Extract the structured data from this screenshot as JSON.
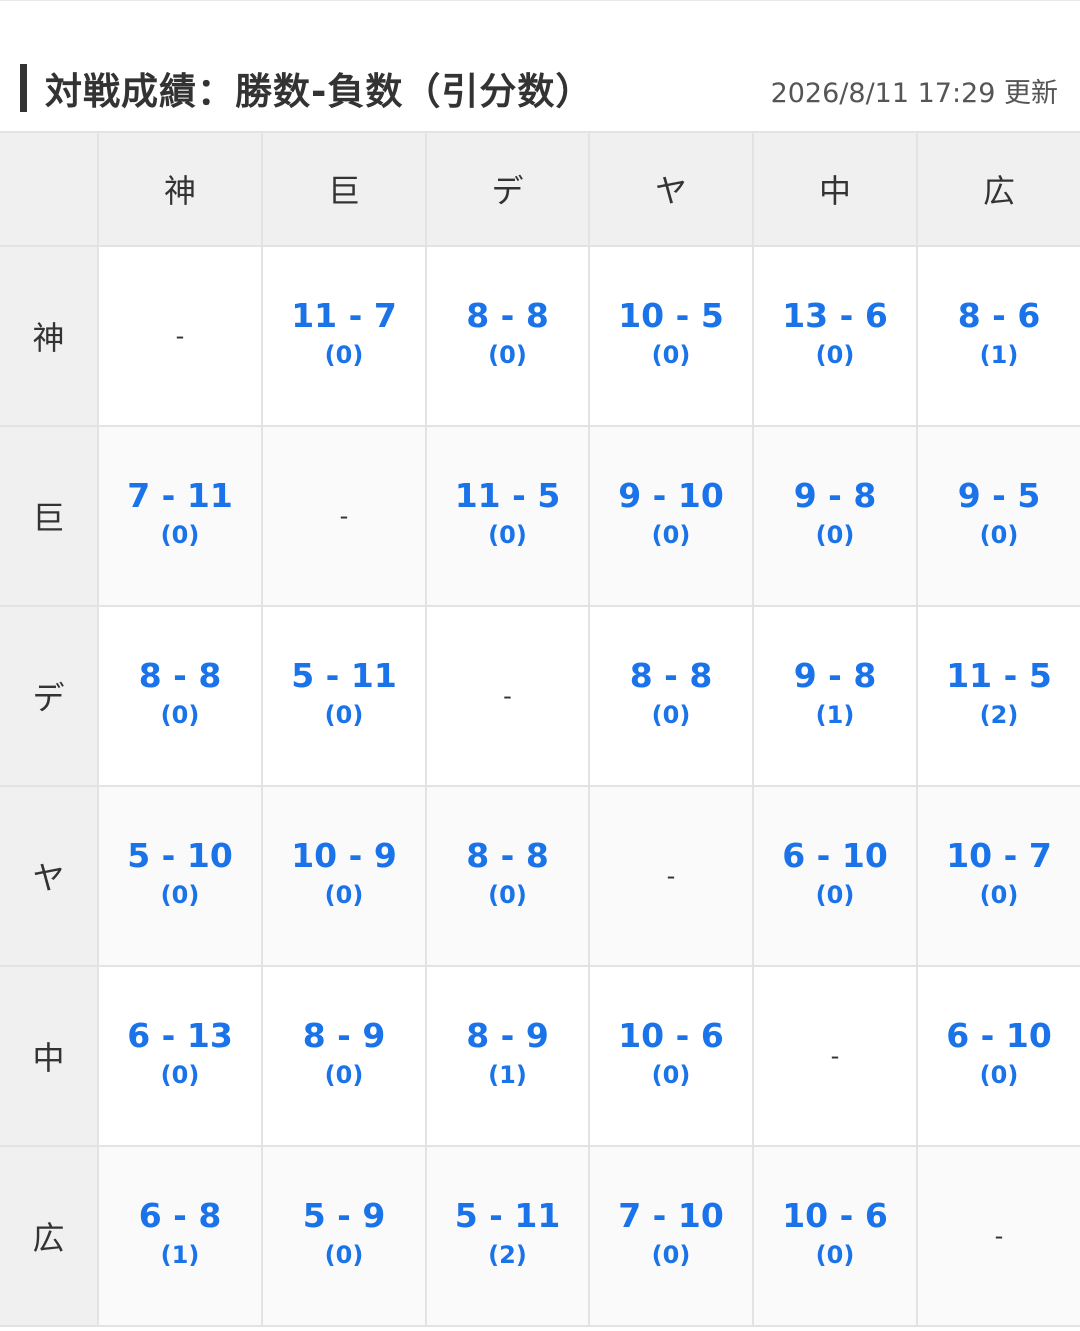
{
  "header": {
    "title": "対戦成績：勝数-負数（引分数）",
    "updated": "2026/8/11 17:29 更新"
  },
  "teams": [
    "神",
    "巨",
    "デ",
    "ヤ",
    "中",
    "広"
  ],
  "rows": [
    {
      "team": "神",
      "cells": [
        {
          "self": "-"
        },
        {
          "score": "11 - 7",
          "draws": "(0)"
        },
        {
          "score": "8 - 8",
          "draws": "(0)"
        },
        {
          "score": "10 - 5",
          "draws": "(0)"
        },
        {
          "score": "13 - 6",
          "draws": "(0)"
        },
        {
          "score": "8 - 6",
          "draws": "(1)"
        }
      ]
    },
    {
      "team": "巨",
      "cells": [
        {
          "score": "7 - 11",
          "draws": "(0)"
        },
        {
          "self": "-"
        },
        {
          "score": "11 - 5",
          "draws": "(0)"
        },
        {
          "score": "9 - 10",
          "draws": "(0)"
        },
        {
          "score": "9 - 8",
          "draws": "(0)"
        },
        {
          "score": "9 - 5",
          "draws": "(0)"
        }
      ]
    },
    {
      "team": "デ",
      "cells": [
        {
          "score": "8 - 8",
          "draws": "(0)"
        },
        {
          "score": "5 - 11",
          "draws": "(0)"
        },
        {
          "self": "-"
        },
        {
          "score": "8 - 8",
          "draws": "(0)"
        },
        {
          "score": "9 - 8",
          "draws": "(1)"
        },
        {
          "score": "11 - 5",
          "draws": "(2)"
        }
      ]
    },
    {
      "team": "ヤ",
      "cells": [
        {
          "score": "5 - 10",
          "draws": "(0)"
        },
        {
          "score": "10 - 9",
          "draws": "(0)"
        },
        {
          "score": "8 - 8",
          "draws": "(0)"
        },
        {
          "self": "-"
        },
        {
          "score": "6 - 10",
          "draws": "(0)"
        },
        {
          "score": "10 - 7",
          "draws": "(0)"
        }
      ]
    },
    {
      "team": "中",
      "cells": [
        {
          "score": "6 - 13",
          "draws": "(0)"
        },
        {
          "score": "8 - 9",
          "draws": "(0)"
        },
        {
          "score": "8 - 9",
          "draws": "(1)"
        },
        {
          "score": "10 - 6",
          "draws": "(0)"
        },
        {
          "self": "-"
        },
        {
          "score": "6 - 10",
          "draws": "(0)"
        }
      ]
    },
    {
      "team": "広",
      "cells": [
        {
          "score": "6 - 8",
          "draws": "(1)"
        },
        {
          "score": "5 - 9",
          "draws": "(0)"
        },
        {
          "score": "5 - 11",
          "draws": "(2)"
        },
        {
          "score": "7 - 10",
          "draws": "(0)"
        },
        {
          "score": "10 - 6",
          "draws": "(0)"
        },
        {
          "self": "-"
        }
      ]
    }
  ],
  "colors": {
    "score": "#1a73e8",
    "header_bg": "#f0f0f0",
    "border": "#e3e3e3"
  }
}
